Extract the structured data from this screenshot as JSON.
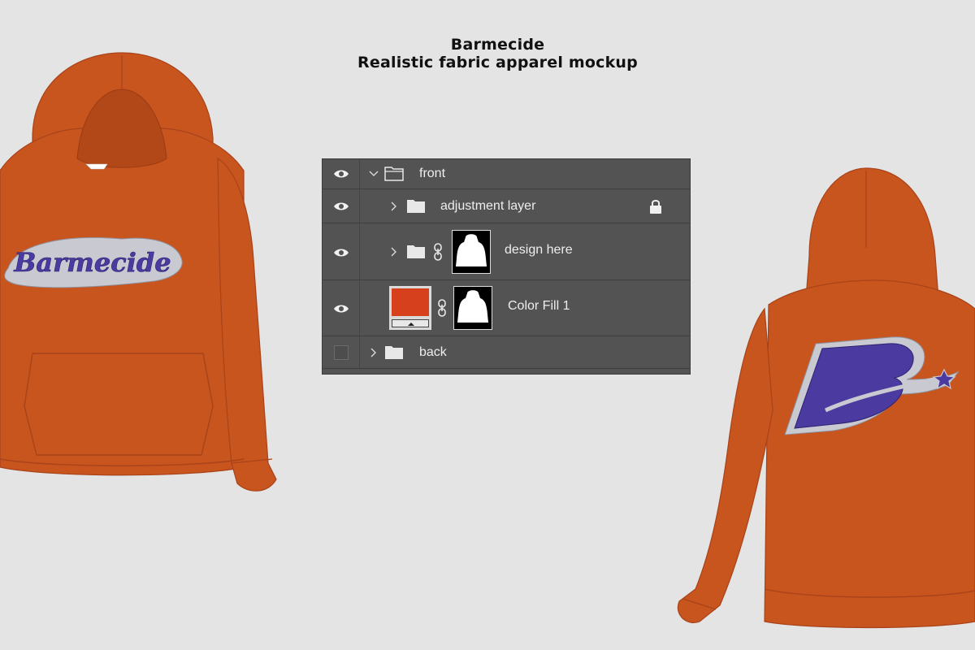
{
  "header": {
    "brand": "Barmecide",
    "subtitle": "Realistic fabric apparel mockup"
  },
  "colors": {
    "hoodie": "#c8541e",
    "patch_purple": "#4b3aa0",
    "patch_border": "#c9c9d2",
    "panel_bg": "#535353",
    "color_fill": "#d7401d"
  },
  "front_hoodie": {
    "patch_text": "Barmecide"
  },
  "back_hoodie": {
    "patch_letter": "B"
  },
  "layers": {
    "rows": [
      {
        "name": "front",
        "visible": true,
        "expanded": true,
        "icon": "folder-icon"
      },
      {
        "name": "adjustment layer",
        "visible": true,
        "expanded": false,
        "locked": true,
        "icon": "folder-icon"
      },
      {
        "name": "design here",
        "visible": true,
        "expanded": false,
        "icon": "folder-icon",
        "mask": true
      },
      {
        "name": "Color Fill 1",
        "visible": true,
        "icon": "color-fill-thumbnail",
        "mask": true
      },
      {
        "name": "back",
        "visible": false,
        "expanded": false,
        "icon": "folder-icon"
      }
    ]
  }
}
